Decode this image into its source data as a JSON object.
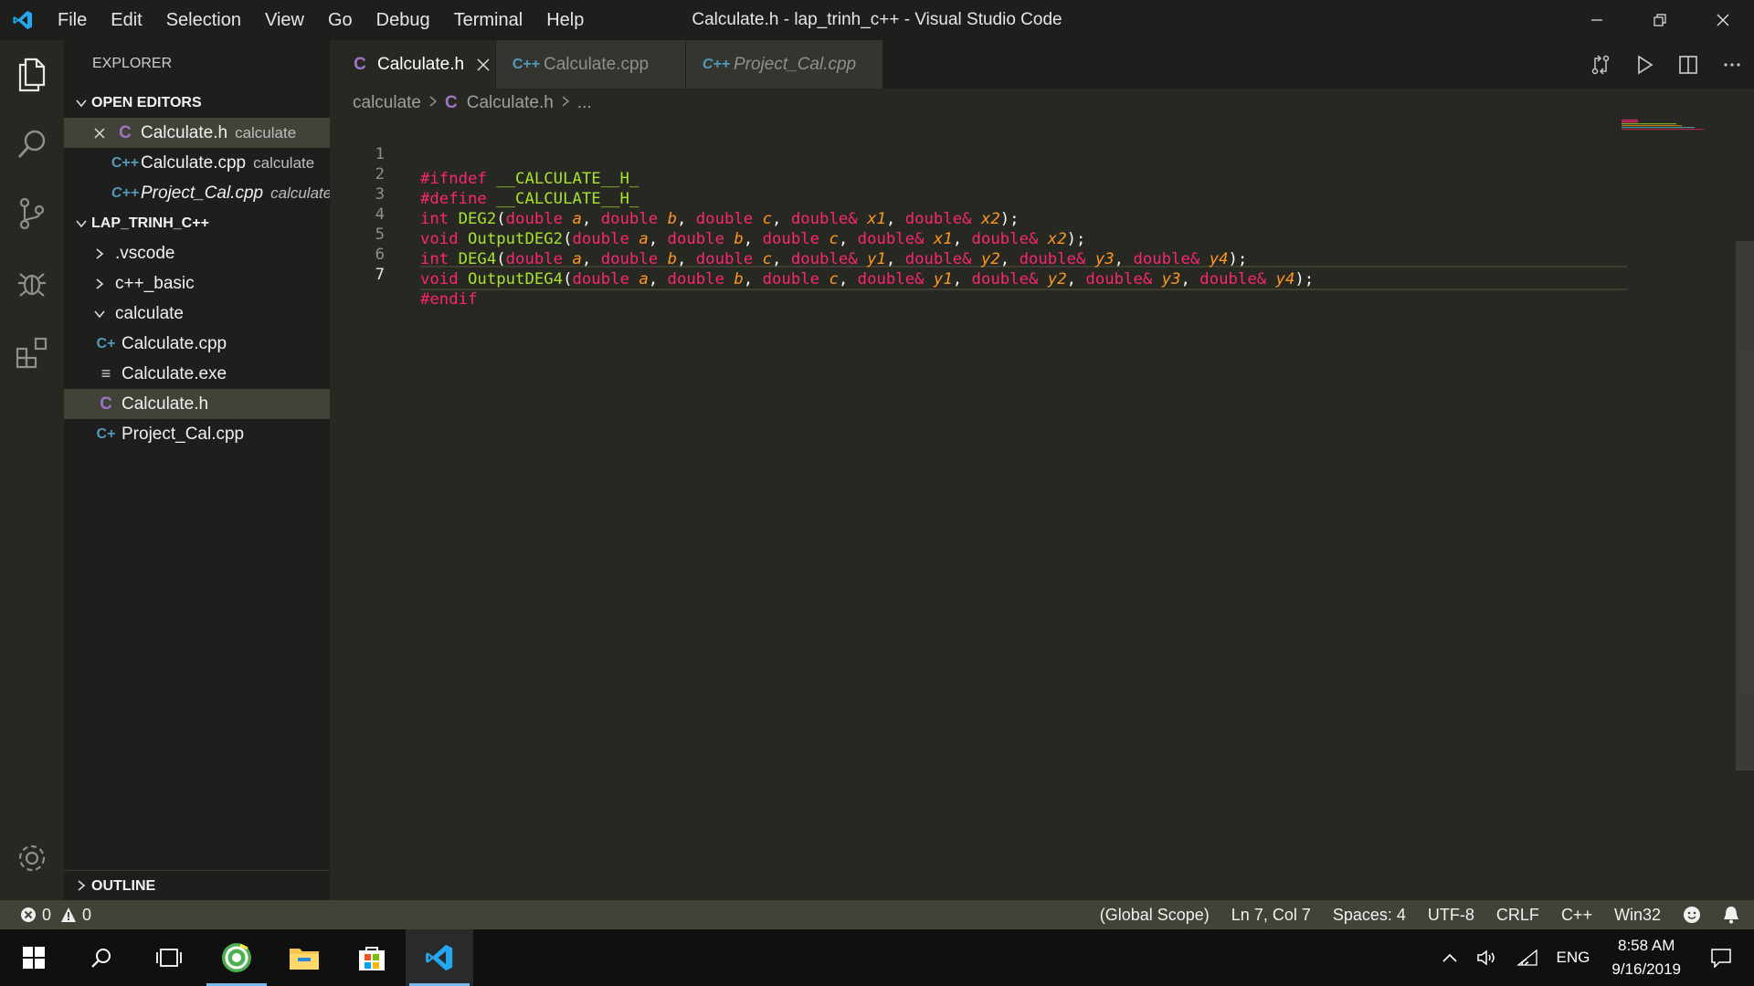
{
  "window": {
    "title": "Calculate.h - lap_trinh_c++ - Visual Studio Code",
    "menu": [
      "File",
      "Edit",
      "Selection",
      "View",
      "Go",
      "Debug",
      "Terminal",
      "Help"
    ]
  },
  "sidebar": {
    "title": "EXPLORER",
    "open_editors": {
      "header": "OPEN EDITORS",
      "items": [
        {
          "icon": "C",
          "name": "Calculate.h",
          "desc": "calculate"
        },
        {
          "icon": "C++",
          "name": "Calculate.cpp",
          "desc": "calculate"
        },
        {
          "icon": "C++",
          "name": "Project_Cal.cpp",
          "desc": "calculate"
        }
      ]
    },
    "workspace": {
      "header": "LAP_TRINH_C++",
      "folders": [
        ".vscode",
        "c++_basic",
        "calculate"
      ],
      "files": [
        "Calculate.cpp",
        "Calculate.exe",
        "Calculate.h",
        "Project_Cal.cpp"
      ]
    },
    "outline_header": "OUTLINE"
  },
  "tabs": [
    {
      "icon": "C",
      "label": "Calculate.h"
    },
    {
      "icon": "C++",
      "label": "Calculate.cpp"
    },
    {
      "icon": "C++",
      "label": "Project_Cal.cpp"
    }
  ],
  "breadcrumbs": {
    "folder": "calculate",
    "icon": "C",
    "file": "Calculate.h",
    "more": "..."
  },
  "editor": {
    "line_numbers": [
      "1",
      "2",
      "3",
      "4",
      "5",
      "6",
      "7"
    ],
    "current_line": 7
  },
  "statusbar": {
    "errors": "0",
    "warnings": "0",
    "scope": "(Global Scope)",
    "position": "Ln 7, Col 7",
    "spaces": "Spaces: 4",
    "encoding": "UTF-8",
    "eol": "CRLF",
    "language": "C++",
    "platform": "Win32"
  },
  "taskbar": {
    "lang": "ENG",
    "time": "8:58 AM",
    "date": "9/16/2019"
  },
  "colors": {
    "keyword": "#f92672",
    "type": "#66d9ef",
    "function": "#a6e22e",
    "param": "#fd971f",
    "vscode_blue": "#23a9f2"
  }
}
